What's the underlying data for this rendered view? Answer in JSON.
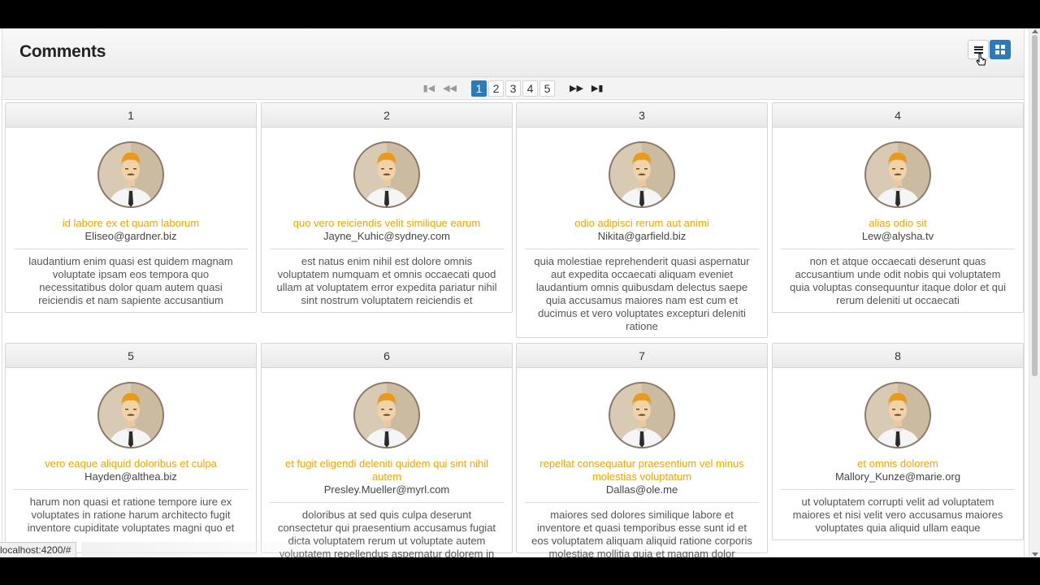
{
  "header": {
    "title": "Comments"
  },
  "icons": {
    "list_view": "list-view-icon",
    "grid_view": "grid-view-icon",
    "avatar": "user-avatar-icon"
  },
  "colors": {
    "accent": "#2c7ab8",
    "name": "#f0a500"
  },
  "paginator": {
    "pages": [
      "1",
      "2",
      "3",
      "4",
      "5"
    ],
    "current": "1"
  },
  "comments": [
    {
      "id": "1",
      "name": "id labore ex et quam laborum",
      "email": "Eliseo@gardner.biz",
      "body": "laudantium enim quasi est quidem magnam voluptate ipsam eos tempora quo necessitatibus dolor quam autem quasi reiciendis et nam sapiente accusantium"
    },
    {
      "id": "2",
      "name": "quo vero reiciendis velit similique earum",
      "email": "Jayne_Kuhic@sydney.com",
      "body": "est natus enim nihil est dolore omnis voluptatem numquam et omnis occaecati quod ullam at voluptatem error expedita pariatur nihil sint nostrum voluptatem reiciendis et"
    },
    {
      "id": "3",
      "name": "odio adipisci rerum aut animi",
      "email": "Nikita@garfield.biz",
      "body": "quia molestiae reprehenderit quasi aspernatur aut expedita occaecati aliquam eveniet laudantium omnis quibusdam delectus saepe quia accusamus maiores nam est cum et ducimus et vero voluptates excepturi deleniti ratione"
    },
    {
      "id": "4",
      "name": "alias odio sit",
      "email": "Lew@alysha.tv",
      "body": "non et atque occaecati deserunt quas accusantium unde odit nobis qui voluptatem quia voluptas consequuntur itaque dolor et qui rerum deleniti ut occaecati"
    },
    {
      "id": "5",
      "name": "vero eaque aliquid doloribus et culpa",
      "email": "Hayden@althea.biz",
      "body": "harum non quasi et ratione tempore iure ex voluptates in ratione harum architecto fugit inventore cupiditate voluptates magni quo et"
    },
    {
      "id": "6",
      "name": "et fugit eligendi deleniti quidem qui sint nihil autem",
      "email": "Presley.Mueller@myrl.com",
      "body": "doloribus at sed quis culpa deserunt consectetur qui praesentium accusamus fugiat dicta voluptatem rerum ut voluptate autem voluptatem repellendus aspernatur dolorem in"
    },
    {
      "id": "7",
      "name": "repellat consequatur praesentium vel minus molestias voluptatum",
      "email": "Dallas@ole.me",
      "body": "maiores sed dolores similique labore et inventore et quasi temporibus esse sunt id et eos voluptatem aliquam aliquid ratione corporis molestiae mollitia quia et magnam dolor"
    },
    {
      "id": "8",
      "name": "et omnis dolorem",
      "email": "Mallory_Kunze@marie.org",
      "body": "ut voluptatem corrupti velit ad voluptatem maiores et nisi velit vero accusamus maiores voluptates quia aliquid ullam eaque"
    }
  ],
  "status_bar": {
    "url": "localhost:4200/#"
  }
}
